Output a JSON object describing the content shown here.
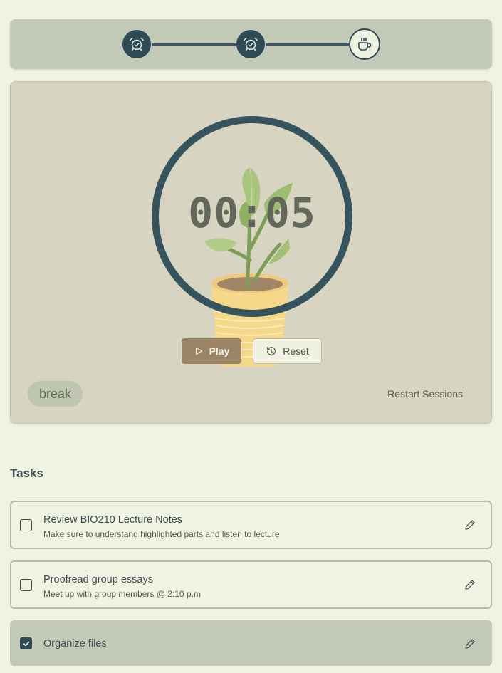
{
  "stepper": {
    "steps": [
      {
        "icon": "alarm-clock-check-icon",
        "status": "done"
      },
      {
        "icon": "alarm-clock-check-icon",
        "status": "done"
      },
      {
        "icon": "coffee-cup-icon",
        "status": "current"
      }
    ]
  },
  "timer": {
    "time": "00:05",
    "play_label": "Play",
    "reset_label": "Reset",
    "mode": "break",
    "restart_label": "Restart Sessions"
  },
  "tasks": {
    "heading": "Tasks",
    "items": [
      {
        "title": "Review BIO210 Lecture Notes",
        "description": "Make sure to understand highlighted parts and listen to lecture",
        "checked": false
      },
      {
        "title": "Proofread group essays",
        "description": "Meet up with group members @ 2:10 p.m",
        "checked": false
      },
      {
        "title": "Organize files",
        "description": "",
        "checked": true
      }
    ]
  },
  "colors": {
    "background": "#f1f3e2",
    "accent": "#2e4a55",
    "play_button": "#9b8566",
    "completed_task": "#c3c9b7"
  }
}
